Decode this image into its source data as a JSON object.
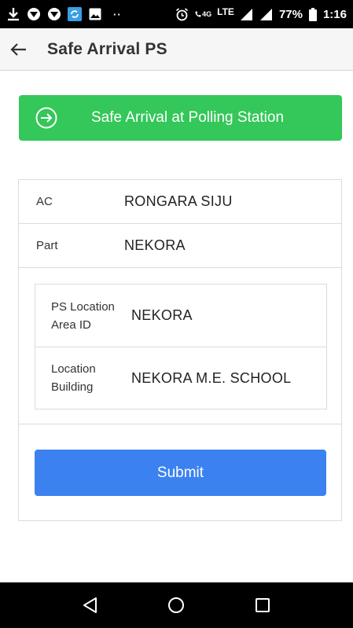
{
  "status_bar": {
    "battery_percent": "77%",
    "time": "1:16",
    "network": "LTE",
    "network_small": "4G",
    "dots": "··"
  },
  "app_bar": {
    "title": "Safe Arrival PS"
  },
  "arrival_button": {
    "label": "Safe Arrival at Polling Station",
    "color": "#34c759"
  },
  "details": {
    "ac_label": "AC",
    "ac_value": "RONGARA SIJU",
    "part_label": "Part",
    "part_value": "NEKORA",
    "ps_location_label": "PS Location Area ID",
    "ps_location_value": "NEKORA",
    "location_building_label": "Location Building",
    "location_building_value": "NEKORA M.E. SCHOOL"
  },
  "submit_button": {
    "label": "Submit",
    "color": "#3b82f0"
  },
  "icons": {
    "back": "arrow-left-icon",
    "arrival": "login-circle-icon",
    "nav_back": "triangle-back-icon",
    "nav_home": "circle-home-icon",
    "nav_recent": "square-recent-icon"
  }
}
